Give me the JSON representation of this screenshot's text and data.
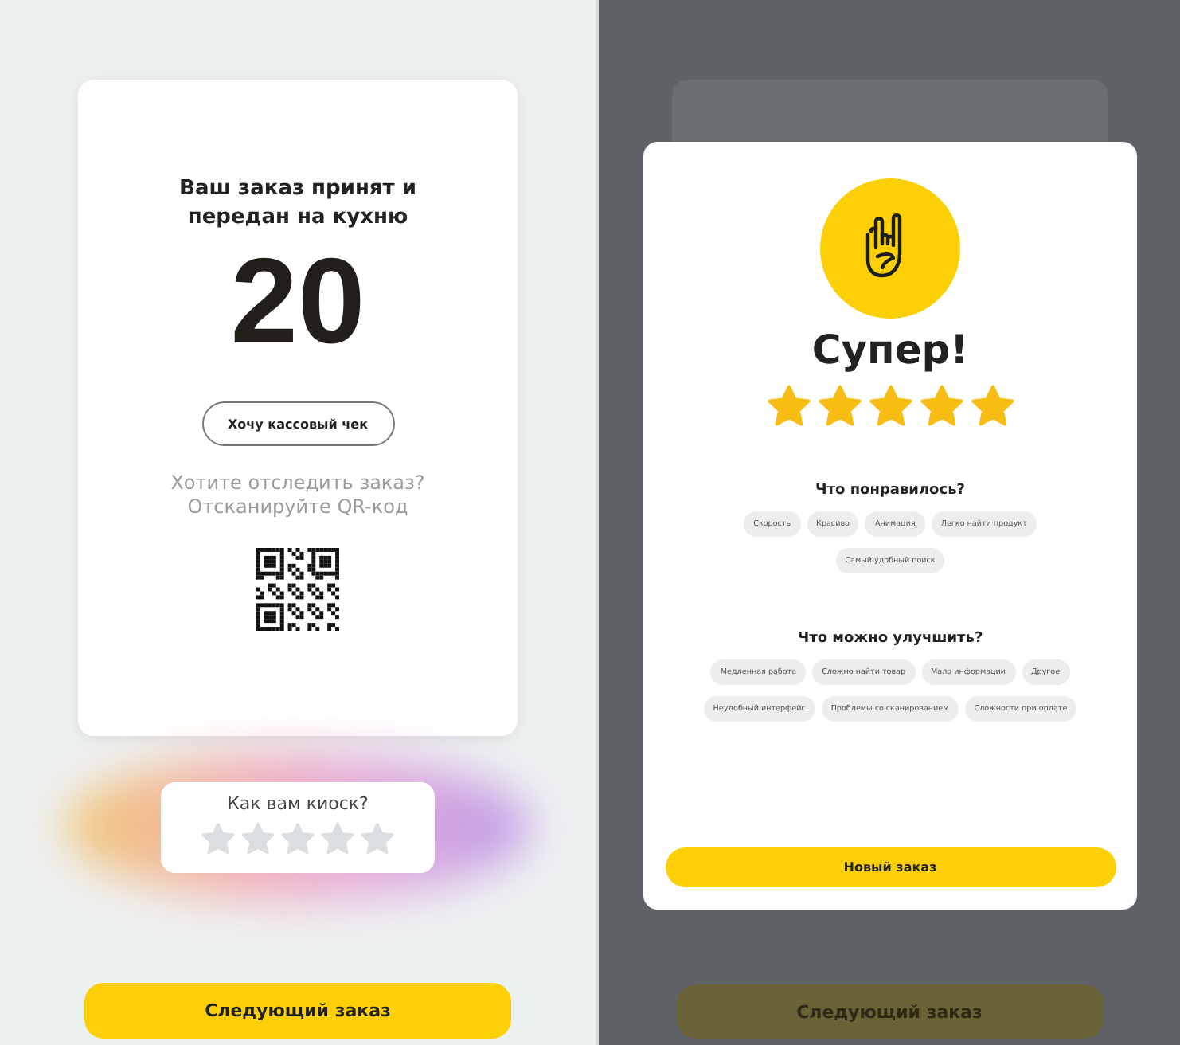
{
  "left_screen": {
    "order_title": "Ваш заказ принят и передан на кухню",
    "order_number": "20",
    "receipt_button": "Хочу кассовый чек",
    "track_text": "Хотите отследить заказ? Отсканируйте QR-код",
    "rating_prompt": "Как вам киоск?",
    "stars": 0,
    "next_button": "Следующий заказ"
  },
  "right_screen": {
    "next_button": "Следующий заказ",
    "modal": {
      "title": "Супер!",
      "stars": 5,
      "liked_title": "Что понравилось?",
      "liked_chips": [
        "Скорость",
        "Красиво",
        "Анимация",
        "Легко найти продукт",
        "Самый удобный поиск"
      ],
      "improve_title": "Что можно улучшить?",
      "improve_chips": [
        "Медленная работа",
        "Сложно найти товар",
        "Мало информации",
        "Другое",
        "Неудобный интерфейс",
        "Проблемы со сканированием",
        "Сложности при оплате"
      ],
      "new_order_button": "Новый заказ"
    }
  }
}
